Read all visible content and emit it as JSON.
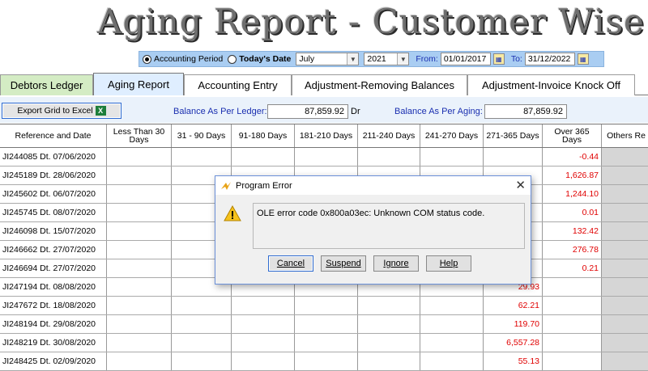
{
  "title": "Aging Report - Customer Wise",
  "period": {
    "accounting_period": "Accounting Period",
    "todays_date": "Today's Date",
    "month": "July",
    "year": "2021",
    "from_label": "From:",
    "from_date": "01/01/2017",
    "to_label": "To:",
    "to_date": "31/12/2022"
  },
  "tabs": [
    {
      "label": "Debtors Ledger"
    },
    {
      "label": "Aging Report"
    },
    {
      "label": "Accounting Entry"
    },
    {
      "label": "Adjustment-Removing Balances"
    },
    {
      "label": "Adjustment-Invoice Knock Off"
    }
  ],
  "toolbar": {
    "export_label": "Export Grid to Excel",
    "ledger_label": "Balance As Per Ledger:",
    "ledger_value": "87,859.92",
    "ledger_suffix": "Dr",
    "aging_label": "Balance As Per Aging:",
    "aging_value": "87,859.92"
  },
  "columns": [
    "Reference and Date",
    "Less Than 30 Days",
    "31 - 90 Days",
    "91-180 Days",
    "181-210 Days",
    "211-240 Days",
    "241-270 Days",
    "271-365 Days",
    "Over 365 Days",
    "Others Re"
  ],
  "rows": [
    {
      "ref": "JI244085 Dt. 07/06/2020",
      "c271": "",
      "c365": "-0.44"
    },
    {
      "ref": "JI245189 Dt. 28/06/2020",
      "c271": "",
      "c365": "1,626.87"
    },
    {
      "ref": "JI245602 Dt. 06/07/2020",
      "c271": "",
      "c365": "1,244.10"
    },
    {
      "ref": "JI245745 Dt. 08/07/2020",
      "c271": "",
      "c365": "0.01"
    },
    {
      "ref": "JI246098 Dt. 15/07/2020",
      "c271": "",
      "c365": "132.42"
    },
    {
      "ref": "JI246662 Dt. 27/07/2020",
      "c271": "",
      "c365": "276.78"
    },
    {
      "ref": "JI246694 Dt. 27/07/2020",
      "c271": "",
      "c365": "0.21"
    },
    {
      "ref": "JI247194 Dt. 08/08/2020",
      "c271": "29.93",
      "c365": ""
    },
    {
      "ref": "JI247672 Dt. 18/08/2020",
      "c271": "62.21",
      "c365": ""
    },
    {
      "ref": "JI248194 Dt. 29/08/2020",
      "c271": "119.70",
      "c365": ""
    },
    {
      "ref": "JI248219 Dt. 30/08/2020",
      "c271": "6,557.28",
      "c365": ""
    },
    {
      "ref": "JI248425 Dt. 02/09/2020",
      "c271": "55.13",
      "c365": ""
    }
  ],
  "dialog": {
    "title": "Program Error",
    "message": "OLE error code 0x800a03ec: Unknown COM status code.",
    "buttons": [
      "Cancel",
      "Suspend",
      "Ignore",
      "Help"
    ]
  },
  "colors": {
    "negative": "#e00000",
    "period_bar": "#a9cdf2",
    "active_tab": "#dfeeff"
  }
}
